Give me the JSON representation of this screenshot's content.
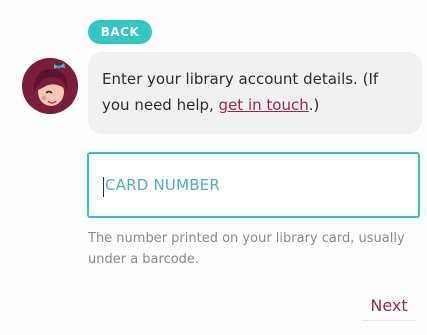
{
  "back_button": {
    "label": "BACK"
  },
  "message": {
    "text_before": "Enter your library account details. (If you need help, ",
    "link_text": "get in touch",
    "text_after": ".)"
  },
  "card_input": {
    "placeholder": "CARD NUMBER",
    "value": ""
  },
  "help_text": "The number printed on your library card, usually under a barcode.",
  "next_button": {
    "label": "Next"
  },
  "colors": {
    "accent": "#34c7c2",
    "link": "#a72448",
    "avatar_bg": "#7a1e3c"
  }
}
